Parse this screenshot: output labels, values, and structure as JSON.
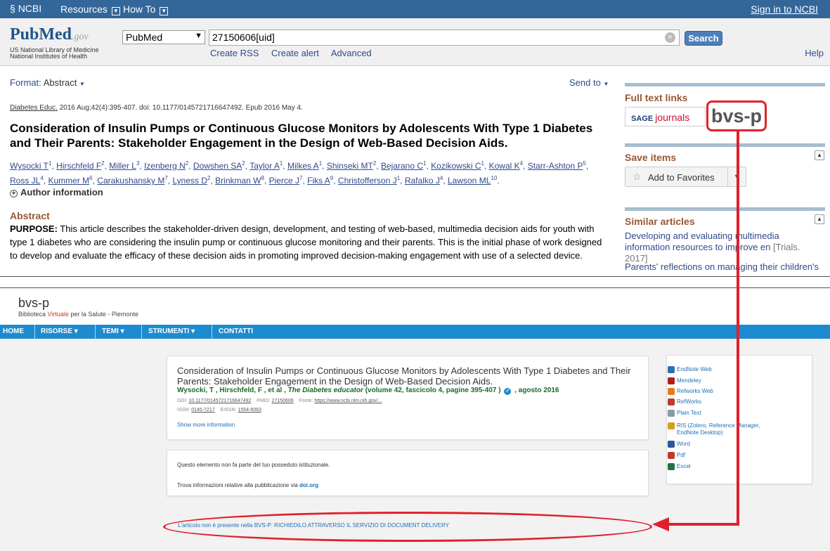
{
  "ncbi_bar": {
    "logo": "NCBI",
    "resources": "Resources",
    "howto": "How To",
    "signin": "Sign in to NCBI"
  },
  "pubmed_header": {
    "logo_pub": "Pub",
    "logo_med": "Med",
    "logo_gov": ".gov",
    "sub1": "US National Library of Medicine",
    "sub2": "National Institutes of Health",
    "db_select": "PubMed",
    "search_value": "27150606[uid]",
    "search_button": "Search",
    "links": [
      "Create RSS",
      "Create alert",
      "Advanced"
    ],
    "help": "Help"
  },
  "toolbar": {
    "format_label": "Format:",
    "format_value": "Abstract",
    "send_to": "Send to"
  },
  "article": {
    "journal": "Diabetes Educ.",
    "citation_rest": "2016 Aug;42(4):395-407. doi: 10.1177/0145721716647492. Epub 2016 May 4.",
    "title": "Consideration of Insulin Pumps or Continuous Glucose Monitors by Adolescents With Type 1 Diabetes and Their Parents: Stakeholder Engagement in the Design of Web-Based Decision Aids.",
    "authors": [
      {
        "name": "Wysocki T",
        "sup": "1"
      },
      {
        "name": "Hirschfeld F",
        "sup": "2"
      },
      {
        "name": "Miller L",
        "sup": "3"
      },
      {
        "name": "Izenberg N",
        "sup": "2"
      },
      {
        "name": "Dowshen SA",
        "sup": "2"
      },
      {
        "name": "Taylor A",
        "sup": "1"
      },
      {
        "name": "Milkes A",
        "sup": "1"
      },
      {
        "name": "Shinseki MT",
        "sup": "2"
      },
      {
        "name": "Bejarano C",
        "sup": "1"
      },
      {
        "name": "Kozikowski C",
        "sup": "1"
      },
      {
        "name": "Kowal K",
        "sup": "4"
      },
      {
        "name": "Starr-Ashton P",
        "sup": "5"
      },
      {
        "name": "Ross JL",
        "sup": "4"
      },
      {
        "name": "Kummer M",
        "sup": "6"
      },
      {
        "name": "Carakushansky M",
        "sup": "7"
      },
      {
        "name": "Lyness D",
        "sup": "2"
      },
      {
        "name": "Brinkman W",
        "sup": "8"
      },
      {
        "name": "Pierce J",
        "sup": "7"
      },
      {
        "name": "Fiks A",
        "sup": "9"
      },
      {
        "name": "Christofferson J",
        "sup": "1"
      },
      {
        "name": "Rafalko J",
        "sup": "4"
      },
      {
        "name": "Lawson ML",
        "sup": "10"
      }
    ],
    "author_info": "Author information",
    "abstract_heading": "Abstract",
    "purpose_label": "PURPOSE:",
    "purpose_text": "This article describes the stakeholder-driven design, development, and testing of web-based, multimedia decision aids for youth with type 1 diabetes who are considering the insulin pump or continuous glucose monitoring and their parents. This is the initial phase of work designed to develop and evaluate the efficacy of these decision aids in promoting improved decision-making engagement with use of a selected device."
  },
  "sidebar": {
    "full_text_heading": "Full text links",
    "sage_a": "SAGE",
    "sage_b": "journals",
    "bvs_link": "bvs-p",
    "save_heading": "Save items",
    "add_favorites": "Add to Favorites",
    "similar_heading": "Similar articles",
    "similar": [
      {
        "text": "Developing and evaluating multimedia information resources to improve en",
        "src": "[Trials. 2017]"
      },
      {
        "text": "Parents' reflections on managing their children's",
        "src": ""
      }
    ]
  },
  "bvs": {
    "title": "bvs-p",
    "sub_a": "Biblioteca ",
    "sub_red": "Virtuale",
    "sub_b": " per la Salute - Piemonte",
    "nav": [
      "HOME",
      "RISORSE ▾",
      "TEMI ▾",
      "STRUMENTI ▾",
      "CONTATTI"
    ],
    "card_title": "Consideration of Insulin Pumps or Continuous Glucose Monitors by Adolescents With Type 1 Diabetes and Their Parents: Stakeholder Engagement in the Design of Web-Based Decision Aids.",
    "card_authors": "Wysocki, T , Hirschfeld, F , et al ,",
    "card_journal": "The Diabetes educator",
    "card_volume": "(volume 42, fascicolo 4, pagine 395-407 )",
    "card_date": ", agosto 2016",
    "doi_label": "DOI:",
    "doi_value": "10.1177/0145721716647492",
    "pmid_label": "PMID:",
    "pmid_value": "27150606",
    "fonte_label": "Fonte:",
    "fonte_value": "https://www.ncbi.nlm.nih.gov/...",
    "issn_label": "ISSN:",
    "issn_value": "0145-7217",
    "eissn_label": "EISSN:",
    "eissn_value": "1554-6063",
    "show_more": "Show more information",
    "not_owned": "Questo elemento non fa parte del tuo posseduto istituzionale.",
    "find_info": "Trova informazioni relative alla pubblicazione via",
    "find_link": "doi.org",
    "document_delivery": "L'articolo non è presente nella BVS-P: RICHIEDILO ATTRAVERSO IL SERVIZIO DI DOCUMENT DELIVERY",
    "export": [
      {
        "label": "EndNote Web",
        "color": "#2c6fb7"
      },
      {
        "label": "Mendeley",
        "color": "#b31b1b"
      },
      {
        "label": "Refworks Web",
        "color": "#e57c1b"
      },
      {
        "label": "RefWorks",
        "color": "#c0392b"
      },
      {
        "label": "Plain Text",
        "color": "#8899aa"
      },
      {
        "label": "RIS (Zotero, Reference Manager, EndNote Desktop)",
        "color": "#d4a017"
      },
      {
        "label": "Word",
        "color": "#2b579a"
      },
      {
        "label": "Pdf",
        "color": "#c0392b"
      },
      {
        "label": "Excel",
        "color": "#217346"
      }
    ]
  },
  "colors": {
    "ncbi_bar": "#336699",
    "bvs_nav": "#1d8bd0",
    "annotation": "#e0212b",
    "section_heading": "#985735"
  }
}
